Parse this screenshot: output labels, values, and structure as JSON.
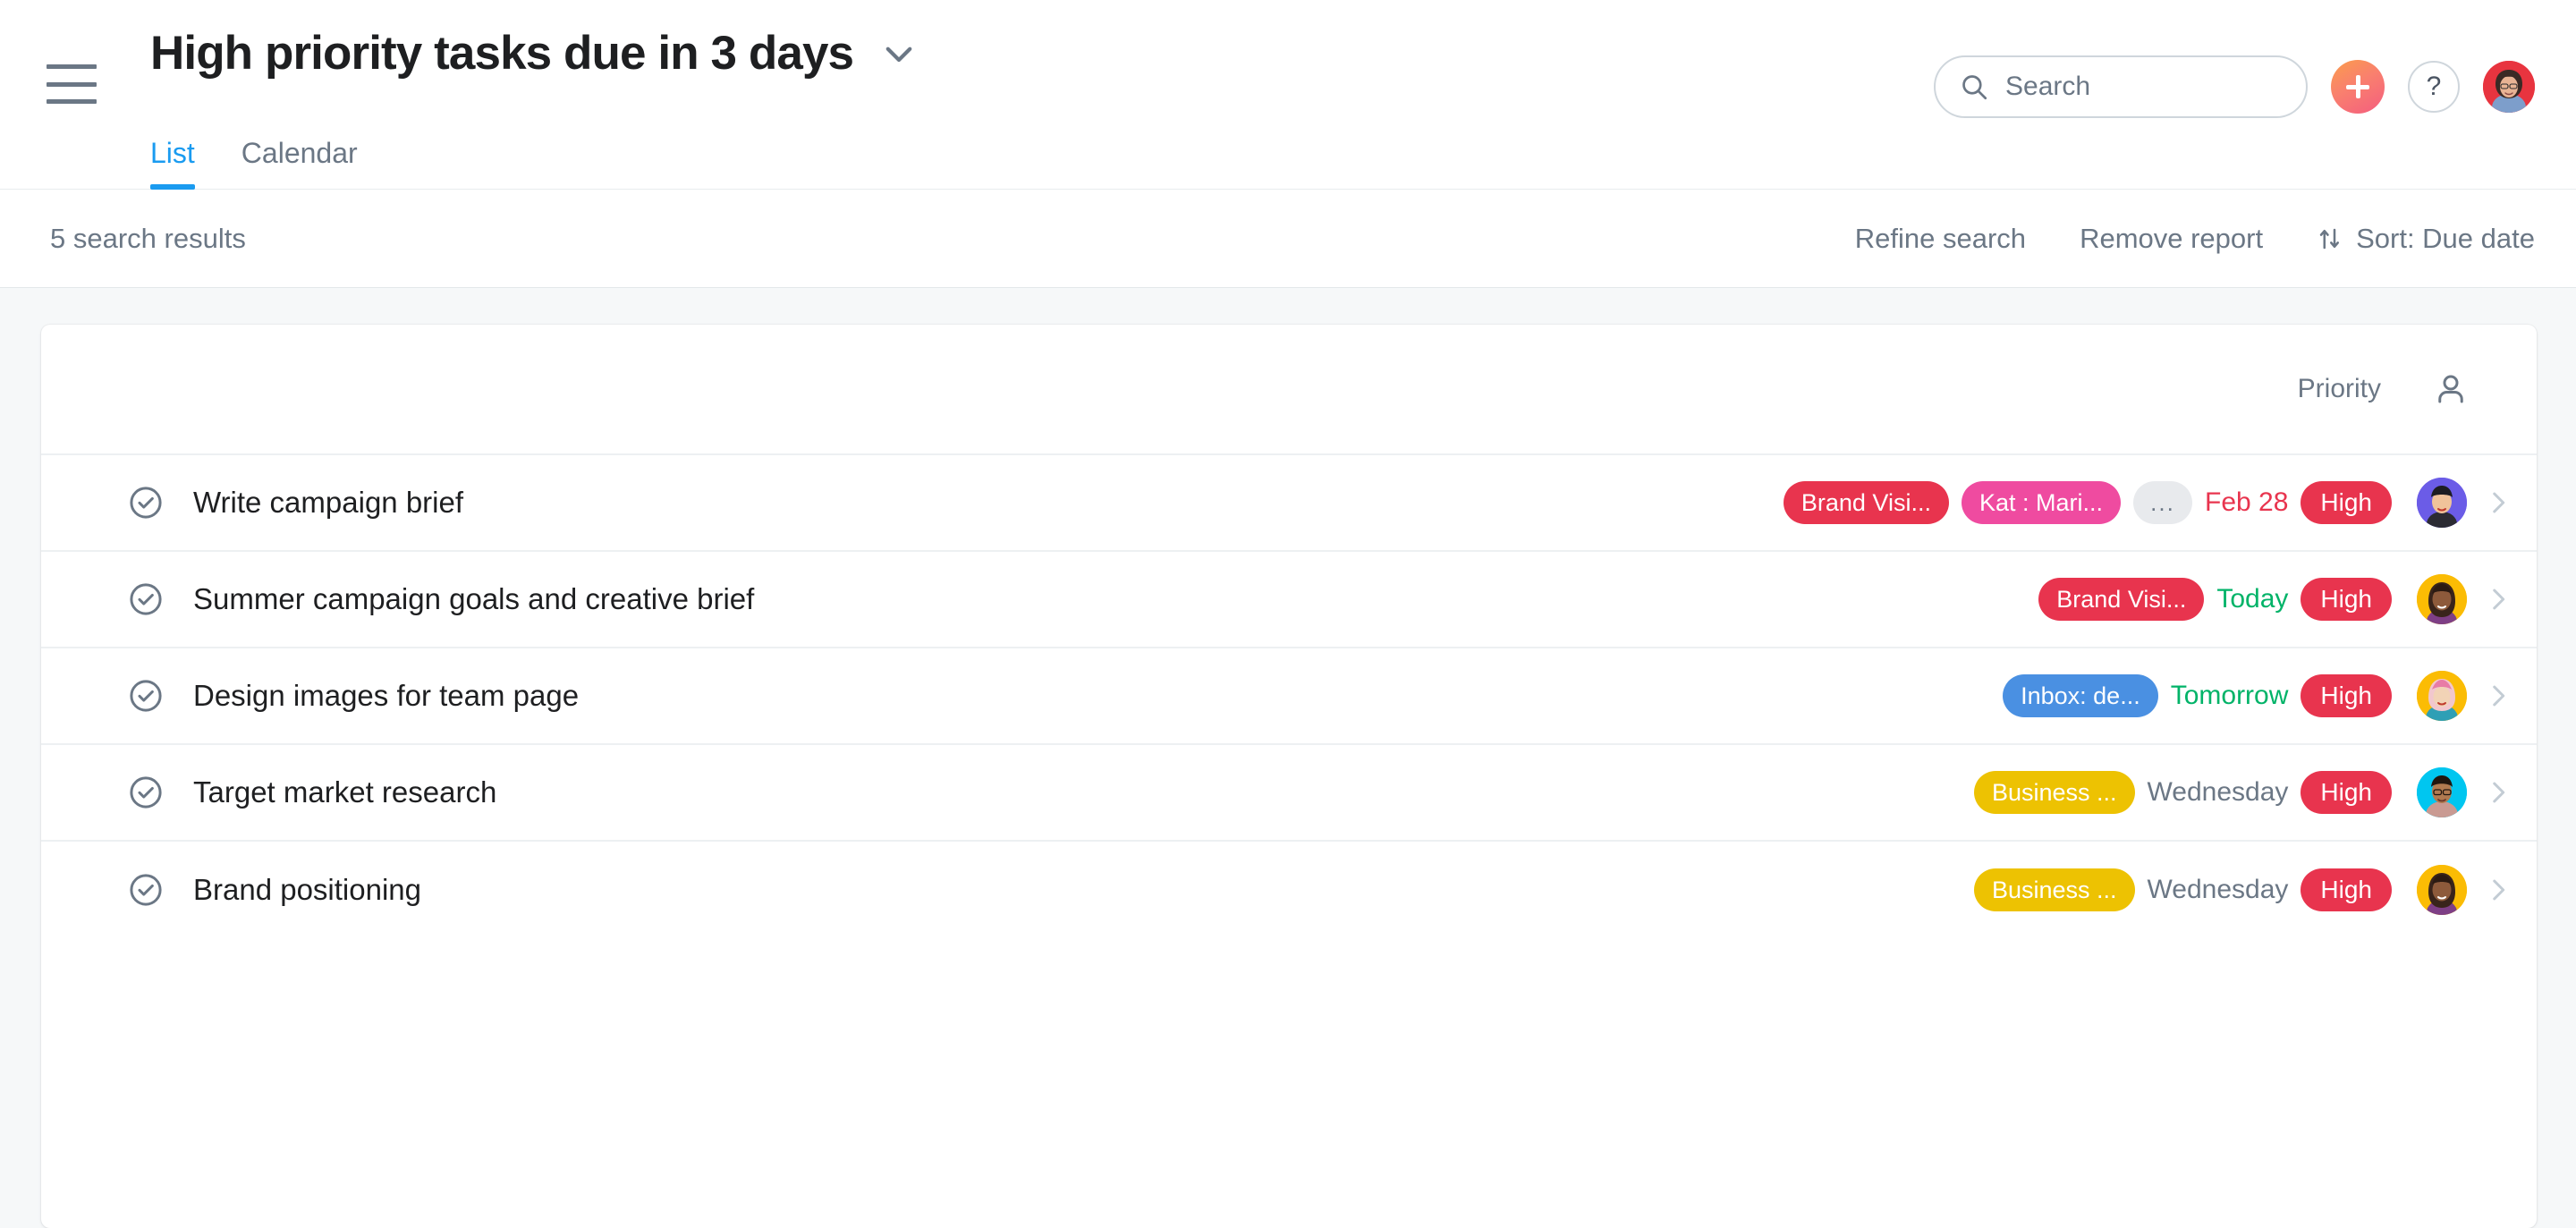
{
  "header": {
    "menu_icon": "hamburger-icon",
    "title": "High priority tasks due in 3 days",
    "title_dropdown_icon": "chevron-down-icon",
    "tabs": [
      {
        "label": "List",
        "active": true
      },
      {
        "label": "Calendar",
        "active": false
      }
    ],
    "search": {
      "icon": "search-icon",
      "placeholder": "Search",
      "value": ""
    },
    "create_button": {
      "icon": "plus-icon",
      "label": ""
    },
    "help_button": {
      "icon": "question-mark-icon",
      "label": "?"
    },
    "profile_avatar": {
      "icon": "avatar",
      "bg": "#e8343f"
    }
  },
  "actionbar": {
    "results_count": "5 search results",
    "refine_search": "Refine search",
    "remove_report": "Remove report",
    "sort_icon": "sort-arrows-icon",
    "sort_label": "Sort: Due date"
  },
  "table": {
    "columns": {
      "priority": "Priority",
      "assignee_icon": "person-icon"
    },
    "rows": [
      {
        "title": "Write campaign brief",
        "checkbox_icon": "check-circle-icon",
        "tags": [
          {
            "label": "Brand Visi...",
            "color": "#e8344e"
          },
          {
            "label": "Kat : Mari...",
            "color": "#ef4ba0"
          }
        ],
        "overflow": "...",
        "due": "Feb 28",
        "due_color": "#e8344e",
        "priority": "High",
        "priority_color": "#e8344e",
        "avatar_bg": "#6b5ce7",
        "chevron_icon": "chevron-right-icon"
      },
      {
        "title": "Summer campaign goals and creative brief",
        "checkbox_icon": "check-circle-icon",
        "tags": [
          {
            "label": "Brand Visi...",
            "color": "#e8344e"
          }
        ],
        "overflow": "",
        "due": "Today",
        "due_color": "#00b368",
        "priority": "High",
        "priority_color": "#e8344e",
        "avatar_bg": "#fbbc04",
        "chevron_icon": "chevron-right-icon"
      },
      {
        "title": "Design images for team page",
        "checkbox_icon": "check-circle-icon",
        "tags": [
          {
            "label": "Inbox: de...",
            "color": "#4a90e2"
          }
        ],
        "overflow": "",
        "due": "Tomorrow",
        "due_color": "#00b368",
        "priority": "High",
        "priority_color": "#e8344e",
        "avatar_bg": "#fbbc04",
        "chevron_icon": "chevron-right-icon"
      },
      {
        "title": "Target market research",
        "checkbox_icon": "check-circle-icon",
        "tags": [
          {
            "label": "Business ...",
            "color": "#edc202"
          }
        ],
        "overflow": "",
        "due": "Wednesday",
        "due_color": "#6b7785",
        "priority": "High",
        "priority_color": "#e8344e",
        "avatar_bg": "#00c6f0",
        "chevron_icon": "chevron-right-icon"
      },
      {
        "title": "Brand positioning",
        "checkbox_icon": "check-circle-icon",
        "tags": [
          {
            "label": "Business ...",
            "color": "#edc202"
          }
        ],
        "overflow": "",
        "due": "Wednesday",
        "due_color": "#6b7785",
        "priority": "High",
        "priority_color": "#e8344e",
        "avatar_bg": "#fbbc04",
        "chevron_icon": "chevron-right-icon"
      }
    ]
  }
}
